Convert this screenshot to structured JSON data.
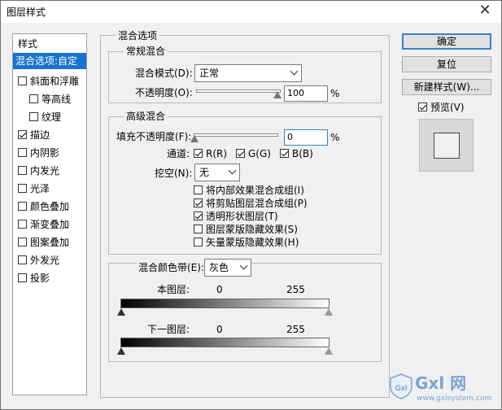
{
  "window": {
    "title": "图层样式",
    "close_glyph": "✕"
  },
  "sidebar": {
    "header": "样式",
    "items": [
      {
        "label": "混合选项:自定",
        "checkbox": false,
        "checked": false,
        "selected": true
      },
      {
        "label": "斜面和浮雕",
        "checkbox": true,
        "checked": false
      },
      {
        "label": "等高线",
        "checkbox": true,
        "checked": false,
        "indent": true
      },
      {
        "label": "纹理",
        "checkbox": true,
        "checked": false,
        "indent": true
      },
      {
        "label": "描边",
        "checkbox": true,
        "checked": true
      },
      {
        "label": "内阴影",
        "checkbox": true,
        "checked": false
      },
      {
        "label": "内发光",
        "checkbox": true,
        "checked": false
      },
      {
        "label": "光泽",
        "checkbox": true,
        "checked": false
      },
      {
        "label": "颜色叠加",
        "checkbox": true,
        "checked": false
      },
      {
        "label": "渐变叠加",
        "checkbox": true,
        "checked": false
      },
      {
        "label": "图案叠加",
        "checkbox": true,
        "checked": false
      },
      {
        "label": "外发光",
        "checkbox": true,
        "checked": false
      },
      {
        "label": "投影",
        "checkbox": true,
        "checked": false
      }
    ]
  },
  "blend_options": {
    "title": "混合选项",
    "general": {
      "title": "常规混合",
      "mode_label": "混合模式(D):",
      "mode_value": "正常",
      "opacity_label": "不透明度(O):",
      "opacity_value": "100",
      "opacity_unit": "%",
      "opacity_level": 1.0
    },
    "advanced": {
      "title": "高级混合",
      "fill_label": "填充不透明度(F):",
      "fill_value": "0",
      "fill_unit": "%",
      "fill_level": 0.0,
      "channels_label": "通道:",
      "channel_r": "R(R)",
      "channel_g": "G(G)",
      "channel_b": "B(B)",
      "knockout_label": "挖空(N):",
      "knockout_value": "无",
      "options": [
        {
          "label": "将内部效果混合成组(I)",
          "checked": false
        },
        {
          "label": "将剪贴图层混合成组(P)",
          "checked": true
        },
        {
          "label": "透明形状图层(T)",
          "checked": true
        },
        {
          "label": "图层蒙版隐藏效果(S)",
          "checked": false
        },
        {
          "label": "矢量蒙版隐藏效果(H)",
          "checked": false
        }
      ]
    },
    "blend_if": {
      "label": "混合颜色带(E):",
      "value": "灰色",
      "this_layer_label": "本图层:",
      "underlying_label": "下一图层:",
      "min": "0",
      "max": "255"
    }
  },
  "buttons": {
    "ok": "确定",
    "reset": "复位",
    "new_style": "新建样式(W)...",
    "preview_label": "预览(V)"
  },
  "watermark": {
    "brand": "Gxl 网",
    "url": "www.gxlsystem.com"
  }
}
